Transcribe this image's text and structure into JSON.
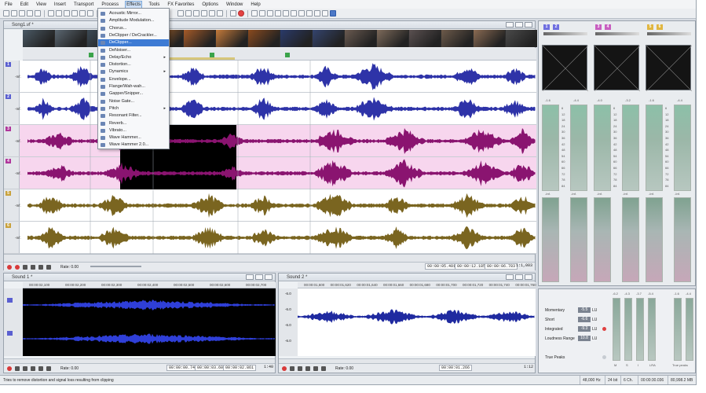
{
  "menubar": [
    "File",
    "Edit",
    "View",
    "Insert",
    "Transport",
    "Process",
    "Effects",
    "Tools",
    "FX Favorites",
    "Options",
    "Window",
    "Help"
  ],
  "active_menu": "Effects",
  "effects_menu": [
    {
      "label": "Acoustic Mirror...",
      "sub": false
    },
    {
      "label": "Amplitude Modulation...",
      "sub": false
    },
    {
      "label": "Chorus...",
      "sub": false
    },
    {
      "label": "DeClipper / DeCrackler...",
      "sub": false
    },
    {
      "label": "DeClipper...",
      "sub": false,
      "highlight": true
    },
    {
      "label": "DeNoiser...",
      "sub": false
    },
    {
      "label": "Delay/Echo",
      "sub": true
    },
    {
      "label": "Distortion...",
      "sub": false
    },
    {
      "label": "Dynamics",
      "sub": true
    },
    {
      "label": "Envelope...",
      "sub": false
    },
    {
      "label": "Flange/Wah-wah...",
      "sub": false
    },
    {
      "label": "Gapper/Snipper...",
      "sub": false
    },
    {
      "label": "Noise Gate...",
      "sub": false
    },
    {
      "label": "Pitch",
      "sub": true
    },
    {
      "label": "Resonant Filter...",
      "sub": false
    },
    {
      "label": "Reverb...",
      "sub": false
    },
    {
      "label": "Vibrato...",
      "sub": false
    },
    {
      "label": "Wave Hammer...",
      "sub": false
    },
    {
      "label": "Wave Hammer 2.0...",
      "sub": false
    }
  ],
  "main_window": {
    "title": "Song1.vf *",
    "rate_label": "Rate: 0.00",
    "time_start": "00:00:05.401",
    "time_end": "00:00:12.185",
    "time_length": "00:00:06.783",
    "zoom": "1:1,003",
    "tracks": [
      {
        "num": "1",
        "num2": "2",
        "color": "#5a5fd0",
        "db_top": "-Inf.",
        "db_bottom": "-Inf.",
        "wave": "#2e33a8",
        "bg": "#ffffff"
      },
      {
        "num": "3",
        "num2": "4",
        "color": "#b0379c",
        "db_top": "-Inf.",
        "db_bottom": "-Inf.",
        "wave": "#8a1470",
        "bg": "#f7d6ee"
      },
      {
        "num": "5",
        "num2": "6",
        "color": "#c9a23c",
        "db_top": "-Inf.",
        "db_bottom": "-Inf.",
        "wave": "#7a6520",
        "bg": "#ffffff"
      }
    ]
  },
  "sound1": {
    "title": "Sound 1 *",
    "ruler": [
      "00:00:02,100",
      "00:00:02,200",
      "00:00:02,300",
      "00:00:02,400",
      "00:00:02,500",
      "00:00:02,600",
      "00:00:02,700"
    ],
    "rate_label": "Rate: 0.00",
    "time_start": "00:00:00.747",
    "time_end": "00:00:03.609",
    "time_length": "00:00:02.861",
    "zoom": "1:40"
  },
  "sound2": {
    "title": "Sound 2 *",
    "ruler": [
      "00:00:01,600",
      "00:00:01,620",
      "00:00:01,640",
      "00:00:01,660",
      "00:00:01,680",
      "00:00:01,700",
      "00:00:01,720",
      "00:00:01,740",
      "00:00:01,760"
    ],
    "db": [
      "-6.0",
      "-6.0",
      "-6.0",
      "-6.0"
    ],
    "rate_label": "Rate: 0.00",
    "time_start": "00:00:01.266",
    "zoom": "1:12"
  },
  "meters": {
    "groups": [
      {
        "label_a": "1",
        "label_b": "2",
        "color": "#6f6fe0",
        "peak_l": "-1.6",
        "peak_r": "-4.4"
      },
      {
        "label_a": "3",
        "label_b": "4",
        "color": "#c85ec0",
        "peak_l": "-4.0",
        "peak_r": "-3.2"
      },
      {
        "label_a": "5",
        "label_b": "6",
        "color": "#e0b640",
        "peak_l": "-1.6",
        "peak_r": "-4.4"
      }
    ],
    "scale": [
      "6",
      "12",
      "18",
      "24",
      "30",
      "36",
      "42",
      "48",
      "54",
      "60",
      "66",
      "72",
      "78",
      "84"
    ],
    "inf_labels": [
      "-Inf.",
      "-Inf.",
      "-Inf.",
      "-Inf.",
      "-Inf.",
      "-Inf."
    ]
  },
  "loudness": {
    "momentary_label": "Momentary",
    "momentary_value": "-5.5",
    "momentary_unit": "LU",
    "short_label": "Short",
    "short_value": "-6.6",
    "short_unit": "LU",
    "integrated_label": "Integrated",
    "integrated_value": "-9.3",
    "integrated_unit": "LU",
    "range_label": "Loudness Range",
    "range_value": "10.8",
    "range_unit": "LU",
    "true_peaks_label": "True Peaks",
    "top_values": [
      "-6.2",
      "-4.3",
      "-3.7",
      "-5.4",
      "-1.6",
      "-4.4"
    ],
    "bottom_labels": [
      "M",
      "S",
      "I",
      "LRA",
      "True peaks"
    ]
  },
  "status": {
    "hint": "Tries to remove distortion and signal loss resulting from clipping",
    "rate": "48,000 Hz",
    "bits": "24 bit",
    "channels": "6 Ch.",
    "length": "00:00:30.036",
    "disk": "80,998.2 MB"
  }
}
